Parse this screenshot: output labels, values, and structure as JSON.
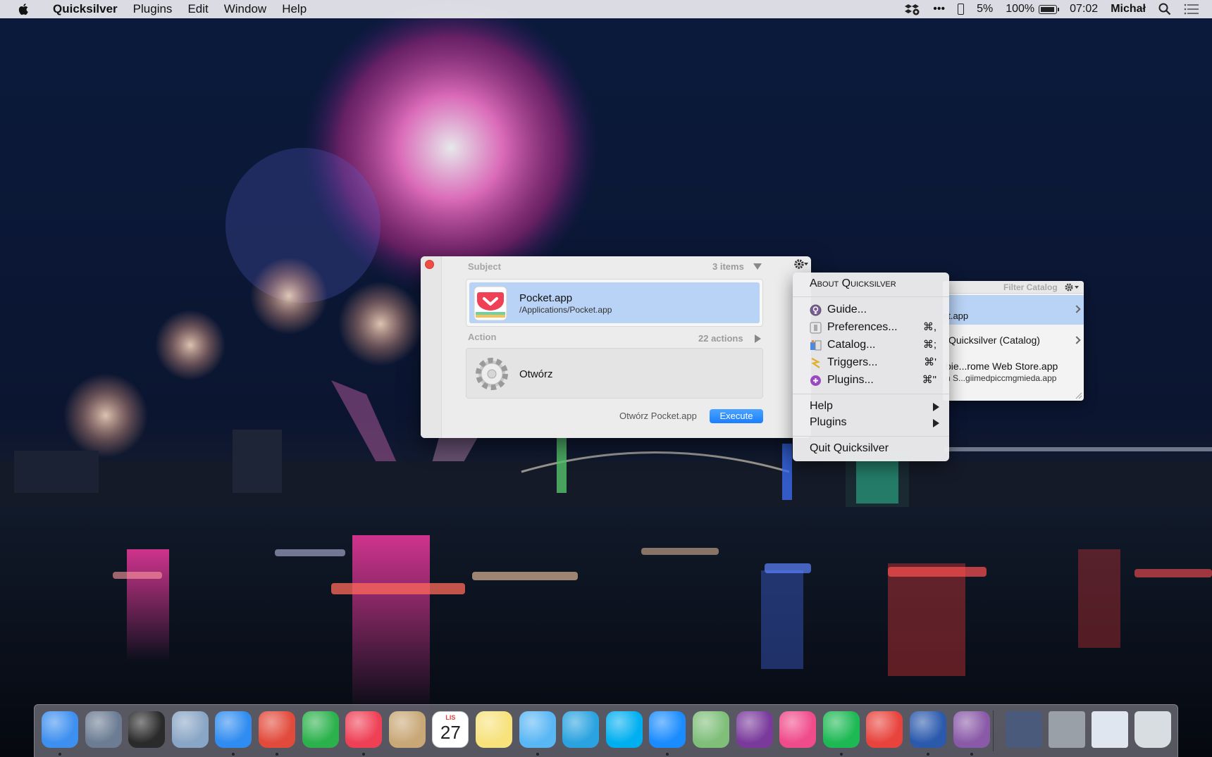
{
  "menubar": {
    "app_name": "Quicksilver",
    "menus": [
      "Plugins",
      "Edit",
      "Window",
      "Help"
    ],
    "status": {
      "more": "•••",
      "cpu": "5%",
      "battery": "100%",
      "battery_level": 1.0,
      "time": "07:02",
      "user": "Michał"
    }
  },
  "quicksilver": {
    "subject_label": "Subject",
    "subject_count": "3 items",
    "subject_name": "Pocket.app",
    "subject_path": "/Applications/Pocket.app",
    "action_label": "Action",
    "action_count": "22 actions",
    "action_name": "Otwórz",
    "summary": "Otwórz Pocket.app",
    "execute_label": "Execute"
  },
  "gear_menu": {
    "about": "About Quicksilver",
    "items": [
      {
        "label": "Guide...",
        "shortcut": "",
        "icon": "guide-icon"
      },
      {
        "label": "Preferences...",
        "shortcut": "⌘,",
        "icon": "preferences-icon"
      },
      {
        "label": "Catalog...",
        "shortcut": "⌘;",
        "icon": "catalog-icon"
      },
      {
        "label": "Triggers...",
        "shortcut": "⌘'",
        "icon": "triggers-icon"
      },
      {
        "label": "Plugins...",
        "shortcut": "⌘\"",
        "icon": "plugins-icon"
      }
    ],
    "submenus": [
      "Help",
      "Plugins"
    ],
    "quit": "Quit Quicksilver"
  },
  "catalog_panel": {
    "filter_label": "Filter Catalog",
    "rows": [
      {
        "title": "et.app",
        "subtitle": ""
      },
      {
        "title": "Quicksilver (Catalog)",
        "subtitle": ""
      },
      {
        "title": "bie...rome Web Store.app",
        "subtitle": "n S...giimedpiccmgmieda.app"
      }
    ]
  },
  "dock": {
    "apps": [
      {
        "name": "finder-icon",
        "color": "#3d8ff0"
      },
      {
        "name": "launchpad-icon",
        "color": "#6b7c93"
      },
      {
        "name": "mission-control-icon",
        "color": "#2a2a2a"
      },
      {
        "name": "preview-icon",
        "color": "#8aa6c6"
      },
      {
        "name": "safari-icon",
        "color": "#2f8cf0"
      },
      {
        "name": "chrome-icon",
        "color": "#e24a3b"
      },
      {
        "name": "feedly-icon",
        "color": "#2bb24c"
      },
      {
        "name": "pocket-icon",
        "color": "#ef4056"
      },
      {
        "name": "contacts-icon",
        "color": "#c9a878"
      },
      {
        "name": "calendar-icon",
        "color": "#ffffff"
      },
      {
        "name": "notes-icon",
        "color": "#f7e27c"
      },
      {
        "name": "messages-icon",
        "color": "#5ab7f5"
      },
      {
        "name": "telegram-icon",
        "color": "#2aa3e0"
      },
      {
        "name": "skype-icon",
        "color": "#00aff0"
      },
      {
        "name": "messenger-icon",
        "color": "#1a8cff"
      },
      {
        "name": "maps-icon",
        "color": "#7fbf7a"
      },
      {
        "name": "onenote-icon",
        "color": "#7a3a9c"
      },
      {
        "name": "itunes-icon",
        "color": "#f04b8a"
      },
      {
        "name": "spotify-icon",
        "color": "#1db954"
      },
      {
        "name": "transmit-icon",
        "color": "#e8433c"
      },
      {
        "name": "word-icon",
        "color": "#2b5aad"
      },
      {
        "name": "quicksilver-icon",
        "color": "#8a5aa8"
      }
    ],
    "calendar_month": "LIS",
    "calendar_day": "27",
    "stacks": [
      {
        "name": "photo-stack-icon",
        "color": "#4a5a7a"
      },
      {
        "name": "documents-stack-icon",
        "color": "#9aa0a8"
      },
      {
        "name": "downloads-stack-icon",
        "color": "#dfe6ef"
      },
      {
        "name": "trash-icon",
        "color": "#d8dde2"
      }
    ]
  }
}
